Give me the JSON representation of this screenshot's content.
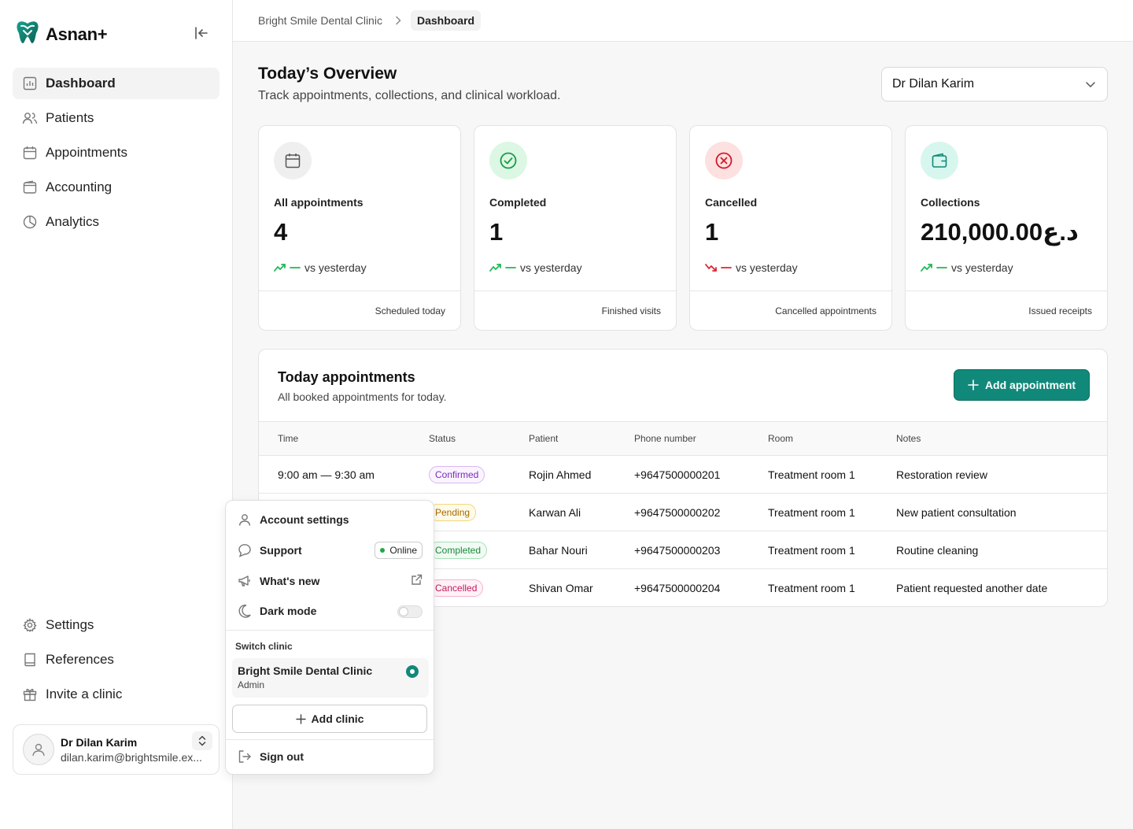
{
  "app": {
    "name": "Asnan+",
    "brand_color": "#11897a"
  },
  "sidebar": {
    "items": [
      {
        "label": "Dashboard",
        "icon": "dashboard-icon",
        "active": true
      },
      {
        "label": "Patients",
        "icon": "users-icon"
      },
      {
        "label": "Appointments",
        "icon": "calendar-icon"
      },
      {
        "label": "Accounting",
        "icon": "wallet-icon"
      },
      {
        "label": "Analytics",
        "icon": "pie-chart-icon"
      }
    ],
    "bottom_items": [
      {
        "label": "Settings",
        "icon": "gear-icon"
      },
      {
        "label": "References",
        "icon": "book-icon"
      },
      {
        "label": "Invite a clinic",
        "icon": "gift-icon"
      }
    ],
    "user": {
      "name": "Dr Dilan Karim",
      "email": "dilan.karim@brightsmile.ex..."
    }
  },
  "breadcrumb": {
    "clinic": "Bright Smile Dental Clinic",
    "current": "Dashboard"
  },
  "header": {
    "title": "Today’s Overview",
    "subtitle": "Track appointments, collections, and clinical workload.",
    "doctor_select": "Dr Dilan Karim"
  },
  "stats": [
    {
      "label": "All appointments",
      "value": "4",
      "trend": "up",
      "trend_text": "vs yesterday",
      "footer": "Scheduled today"
    },
    {
      "label": "Completed",
      "value": "1",
      "trend": "up",
      "trend_text": "vs yesterday",
      "footer": "Finished visits"
    },
    {
      "label": "Cancelled",
      "value": "1",
      "trend": "down",
      "trend_text": "vs yesterday",
      "footer": "Cancelled appointments"
    },
    {
      "label": "Collections",
      "value": "210,000.00د.ع",
      "trend": "up",
      "trend_text": "vs yesterday",
      "footer": "Issued receipts"
    }
  ],
  "appointments": {
    "title": "Today appointments",
    "subtitle": "All booked appointments for today.",
    "add_label": "Add appointment",
    "columns": [
      "Time",
      "Status",
      "Patient",
      "Phone number",
      "Room",
      "Notes"
    ],
    "rows": [
      {
        "time": "9:00 am — 9:30 am",
        "status": "Confirmed",
        "patient": "Rojin Ahmed",
        "phone": "+9647500000201",
        "room": "Treatment room 1",
        "notes": "Restoration review"
      },
      {
        "time": "",
        "status": "Pending",
        "patient": "Karwan Ali",
        "phone": "+9647500000202",
        "room": "Treatment room 1",
        "notes": "New patient consultation"
      },
      {
        "time": "",
        "status": "Completed",
        "patient": "Bahar Nouri",
        "phone": "+9647500000203",
        "room": "Treatment room 1",
        "notes": "Routine cleaning"
      },
      {
        "time": "",
        "status": "Cancelled",
        "patient": "Shivan Omar",
        "phone": "+9647500000204",
        "room": "Treatment room 1",
        "notes": "Patient requested another date"
      }
    ]
  },
  "user_menu": {
    "account_settings": "Account settings",
    "support": "Support",
    "support_status": "Online",
    "whats_new": "What's new",
    "dark_mode": "Dark mode",
    "dark_mode_on": false,
    "switch_clinic_label": "Switch clinic",
    "clinic_name": "Bright Smile Dental Clinic",
    "clinic_role": "Admin",
    "add_clinic": "Add clinic",
    "sign_out": "Sign out"
  }
}
